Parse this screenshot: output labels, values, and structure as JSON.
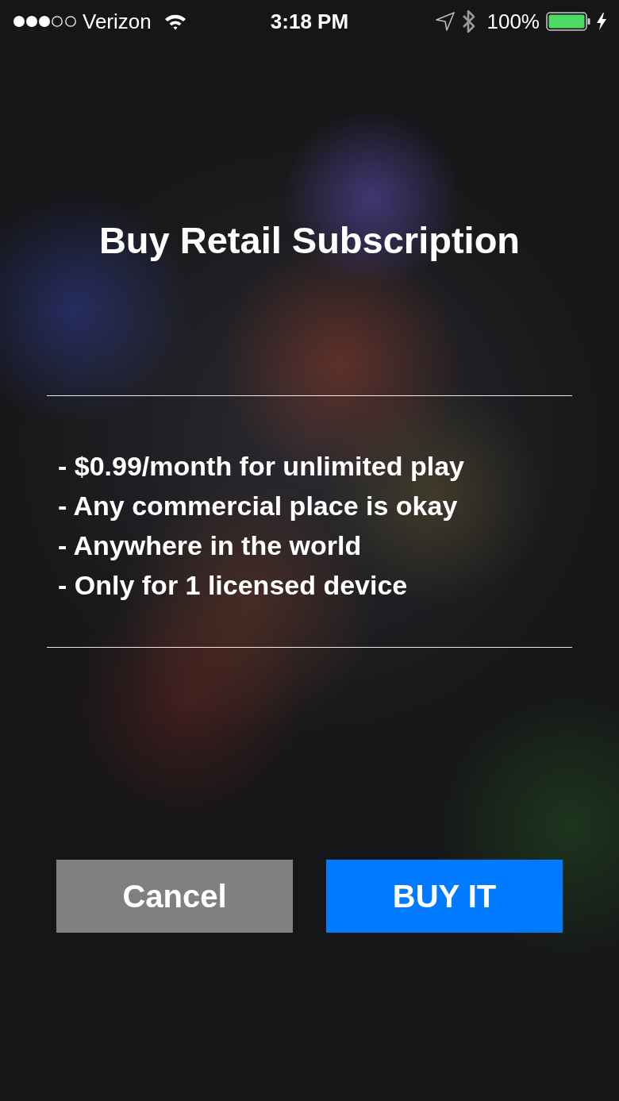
{
  "status_bar": {
    "carrier": "Verizon",
    "time": "3:18 PM",
    "battery_percent": "100%"
  },
  "dialog": {
    "title": "Buy Retail Subscription",
    "features": [
      "- $0.99/month for unlimited play",
      "- Any commercial place is okay",
      "- Anywhere in the world",
      "- Only for 1 licensed device"
    ],
    "buttons": [
      {
        "label": "Cancel",
        "kind": "secondary"
      },
      {
        "label": "BUY IT",
        "kind": "primary"
      }
    ]
  }
}
